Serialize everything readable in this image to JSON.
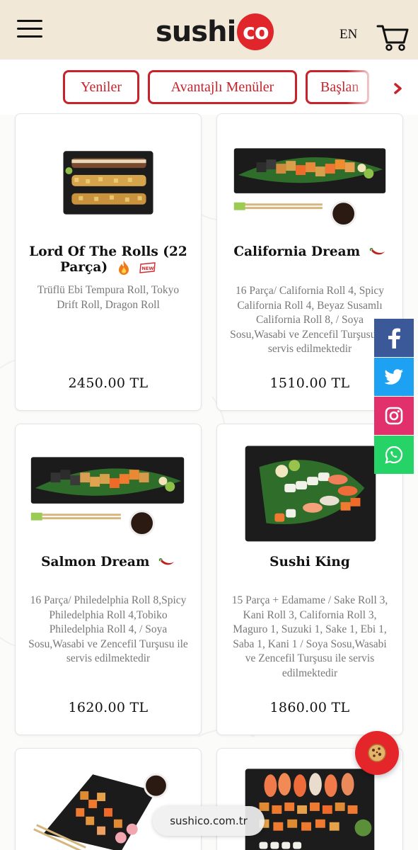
{
  "header": {
    "logo_text": "sushi",
    "logo_circle_text": "co",
    "language": "EN",
    "brand_color": "#e0262b",
    "menu_icon": "hamburger-icon",
    "cart_icon": "cart-icon"
  },
  "categories": [
    {
      "label": "Yeniler"
    },
    {
      "label": "Avantajlı Menüler"
    },
    {
      "label": "Başlan"
    }
  ],
  "products": [
    {
      "name": "Lord Of The Rolls (22 Parça)",
      "name_line1": "Lord Of The Rolls (22",
      "name_line2": "Parça)",
      "badges": [
        "fire-icon",
        "new-badge"
      ],
      "new_badge_text": "NEW",
      "description": "Trüflü Ebi Tempura Roll, Tokyo Drift Roll, Dragon Roll",
      "price": "2450.00 TL"
    },
    {
      "name": "California Dream",
      "badges": [
        "chili-icon"
      ],
      "description": "16 Parça/ California Roll 4, Spicy California Roll 4, Beyaz Susamlı California Roll 8, / Soya Sosu,Wasabi ve Zencefil Turşusu ile servis edilmektedir",
      "price": "1510.00 TL"
    },
    {
      "name": "Salmon Dream",
      "badges": [
        "chili-icon"
      ],
      "description": "16 Parça/ Philedelphia Roll 8,Spicy Philedelphia Roll 4,Tobiko Philedelphia Roll 4, / Soya Sosu,Wasabi ve Zencefil Turşusu ile servis edilmektedir",
      "price": "1620.00 TL"
    },
    {
      "name": "Sushi King",
      "badges": [],
      "description": "15 Parça + Edamame / Sake Roll 3, Kani Roll 3, California Roll 3, Maguro 1, Suzuki 1, Sake 1, Ebi 1, Saba 1, Kani 1 / Soya Sosu,Wasabi ve Zencefil Turşusu ile servis edilmektedir",
      "price": "1860.00 TL"
    }
  ],
  "social": [
    "facebook-icon",
    "twitter-icon",
    "instagram-icon",
    "whatsapp-icon"
  ],
  "browser": {
    "url": "sushico.com.tr"
  }
}
